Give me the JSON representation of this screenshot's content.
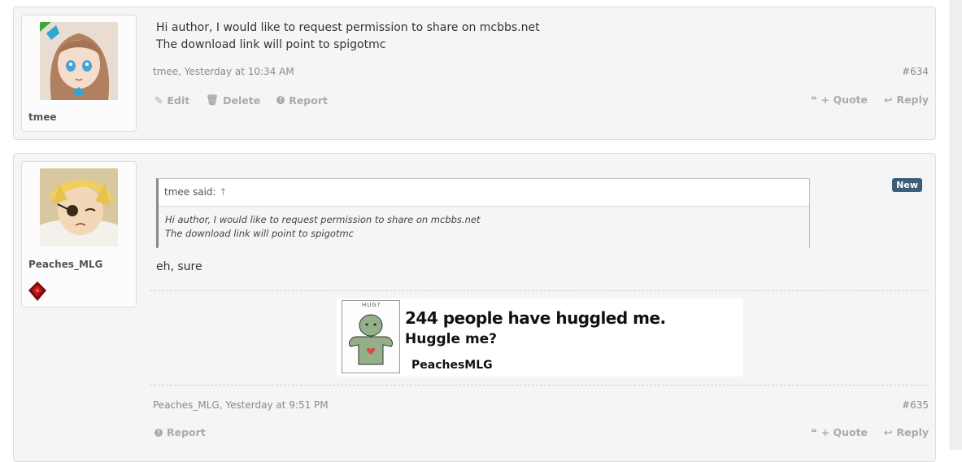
{
  "colors": {
    "post_bg": "#f5f5f5",
    "muted_text": "#8a8a8a",
    "action_text": "#aaaaaa",
    "new_badge": "#3c5e78",
    "quote_arrow": "#e08a3a"
  },
  "posts": [
    {
      "user": {
        "name": "tmee",
        "avatar_icon": "anime-girl-avatar"
      },
      "message": [
        "Hi author, I would like to request permission to share on mcbbs.net",
        "The download link will point to spigotmc"
      ],
      "meta": "tmee, Yesterday at 10:34 AM",
      "number": "#634",
      "actions_left": [
        {
          "label": "Edit",
          "icon": "pencil-icon"
        },
        {
          "label": "Delete",
          "icon": "trash-icon"
        },
        {
          "label": "Report",
          "icon": "info-circle-icon"
        }
      ],
      "actions_right": [
        {
          "label": "+ Quote",
          "icon": "quote-icon"
        },
        {
          "label": "Reply",
          "icon": "reply-icon"
        }
      ]
    },
    {
      "user": {
        "name": "Peaches_MLG",
        "avatar_icon": "anime-boy-avatar",
        "badge_icon": "redstone-icon"
      },
      "new_badge": "New",
      "quote": {
        "header": "tmee said:",
        "arrow": "↑",
        "lines": [
          "Hi author, I would like to request permission to share on mcbbs.net",
          "The download link will point to spigotmc"
        ]
      },
      "message": "eh, sure",
      "signature": {
        "hug_label": "HUG?",
        "line1": "244 people have huggled me.",
        "line2": "Huggle me?",
        "line3": "PeachesMLG"
      },
      "meta": "Peaches_MLG, Yesterday at 9:51 PM",
      "number": "#635",
      "actions_left": [
        {
          "label": "Report",
          "icon": "info-circle-icon"
        }
      ],
      "actions_right": [
        {
          "label": "+ Quote",
          "icon": "quote-icon"
        },
        {
          "label": "Reply",
          "icon": "reply-icon"
        }
      ]
    }
  ]
}
